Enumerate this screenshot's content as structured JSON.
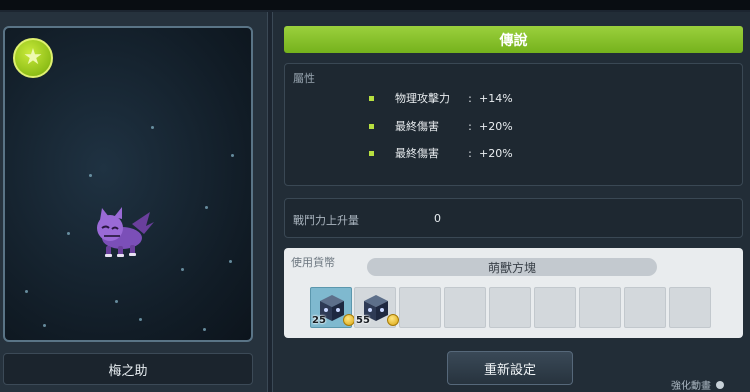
{
  "pet": {
    "name": "梅之助",
    "badge_icon": "star-icon"
  },
  "potential": {
    "grade": "傳說",
    "grade_color": "#8bc534",
    "attributes_title": "屬性",
    "attributes": [
      {
        "name": "物理攻擊力",
        "sep": ":",
        "value": "+14%"
      },
      {
        "name": "最終傷害",
        "sep": ":",
        "value": "+20%"
      },
      {
        "name": "最終傷害",
        "sep": ":",
        "value": "+20%"
      }
    ]
  },
  "combat_power": {
    "label": "戰鬥力上升量",
    "value": "0"
  },
  "currency": {
    "title": "使用貨幣",
    "selected_name": "萌獸方塊",
    "slots": [
      {
        "count": "25",
        "icon": "cube-icon"
      },
      {
        "count": "55",
        "icon": "cube-icon"
      }
    ]
  },
  "actions": {
    "reset_label": "重新設定"
  },
  "footer": {
    "enhance_label": "強化動畫"
  }
}
